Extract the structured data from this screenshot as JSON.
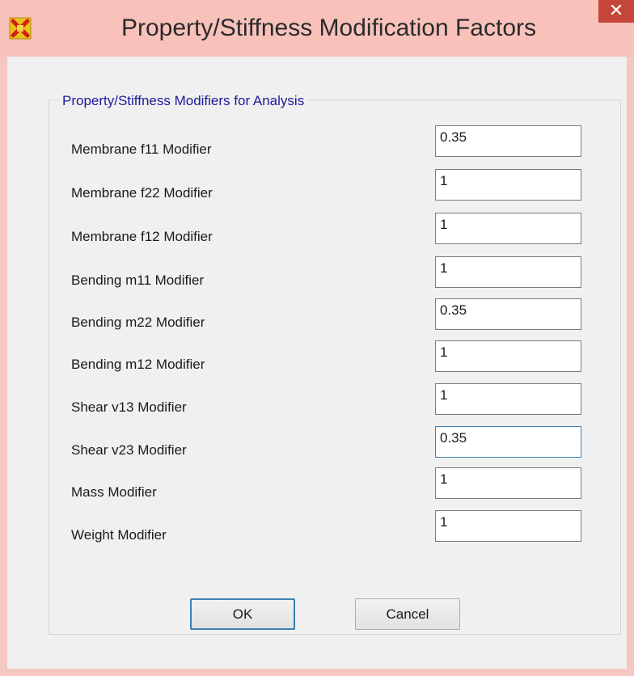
{
  "window": {
    "title": "Property/Stiffness Modification Factors",
    "close_glyph": "✕",
    "app_icon": "app-x-icon"
  },
  "group": {
    "title": "Property/Stiffness Modifiers for Analysis"
  },
  "modifiers": [
    {
      "label": "Membrane f11 Modifier",
      "value": "0.35"
    },
    {
      "label": "Membrane f22 Modifier",
      "value": "1"
    },
    {
      "label": "Membrane f12 Modifier",
      "value": "1"
    },
    {
      "label": "Bending  m11 Modifier",
      "value": "1"
    },
    {
      "label": "Bending  m22 Modifier",
      "value": "0.35"
    },
    {
      "label": "Bending  m12 Modifier",
      "value": "1"
    },
    {
      "label": "Shear  v13 Modifier",
      "value": "1"
    },
    {
      "label": "Shear  v23 Modifier",
      "value": "0.35"
    },
    {
      "label": "Mass Modifier",
      "value": "1"
    },
    {
      "label": "Weight Modifier",
      "value": "1"
    }
  ],
  "buttons": {
    "ok": "OK",
    "cancel": "Cancel"
  },
  "colors": {
    "titlebar": "#f8c2bb",
    "close_button": "#c6463a",
    "group_title": "#1a1a9c",
    "focus_border": "#3c7fb1"
  }
}
